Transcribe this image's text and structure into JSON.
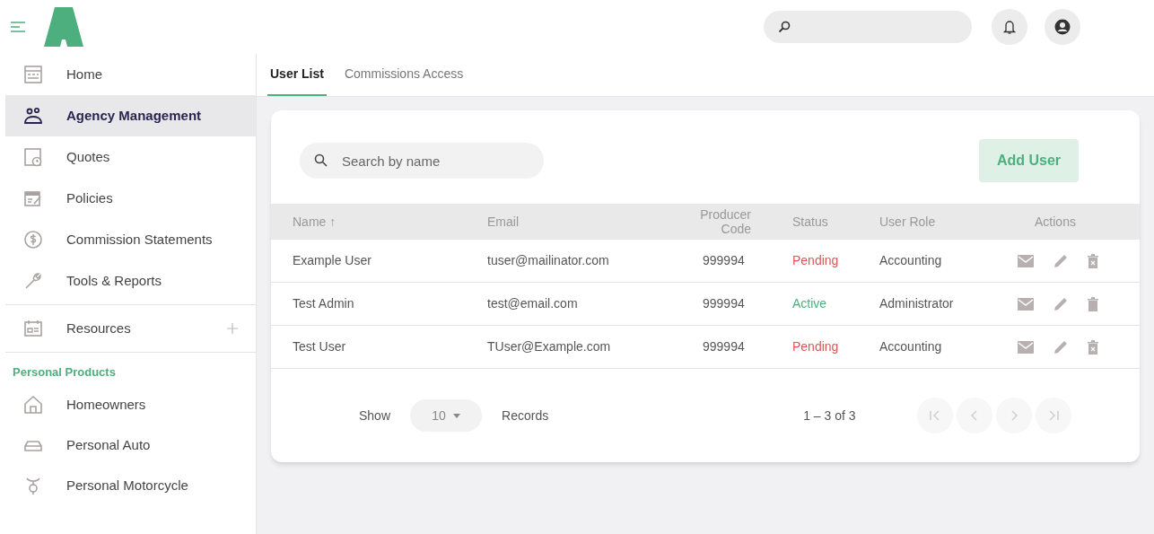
{
  "sidebar": {
    "items": [
      {
        "label": "Home",
        "selected": false,
        "kind": "link"
      },
      {
        "label": "Agency Management",
        "selected": true,
        "kind": "link"
      },
      {
        "label": "Quotes",
        "selected": false,
        "kind": "link"
      },
      {
        "label": "Policies",
        "selected": false,
        "kind": "link"
      },
      {
        "label": "Commission Statements",
        "selected": false,
        "kind": "link"
      },
      {
        "label": "Tools & Reports",
        "selected": false,
        "kind": "link"
      },
      {
        "label": "Resources",
        "selected": false,
        "kind": "expandable"
      }
    ],
    "section_title": "Personal Products",
    "products": [
      {
        "label": "Homeowners"
      },
      {
        "label": "Personal Auto"
      },
      {
        "label": "Personal Motorcycle"
      }
    ]
  },
  "tabs": [
    {
      "label": "User List",
      "selected": true
    },
    {
      "label": "Commissions Access",
      "selected": false
    }
  ],
  "search": {
    "placeholder": "Search by name"
  },
  "add_button": "Add User",
  "table": {
    "columns": [
      "Name ↑",
      "Email",
      "Producer Code",
      "Status",
      "User Role",
      "Actions"
    ],
    "rows": [
      {
        "name": "Example User",
        "email": "tuser@mailinator.com",
        "producer_code": "999994",
        "status": "Pending",
        "color": "#e05555",
        "role": "Accounting",
        "kind": "boxed"
      },
      {
        "name": "Test Admin",
        "email": "test@email.com",
        "producer_code": "999994",
        "status": "Active",
        "color": "#4caf7d",
        "role": "Administrator",
        "kind": "plain"
      },
      {
        "name": "Test User",
        "email": "TUser@Example.com",
        "producer_code": "999994",
        "status": "Pending",
        "color": "#e05555",
        "role": "Accounting",
        "kind": "boxed"
      }
    ]
  },
  "pagination": {
    "show": "Show",
    "page_size": "10",
    "records": "Records",
    "range": "1 – 3 of 3"
  }
}
